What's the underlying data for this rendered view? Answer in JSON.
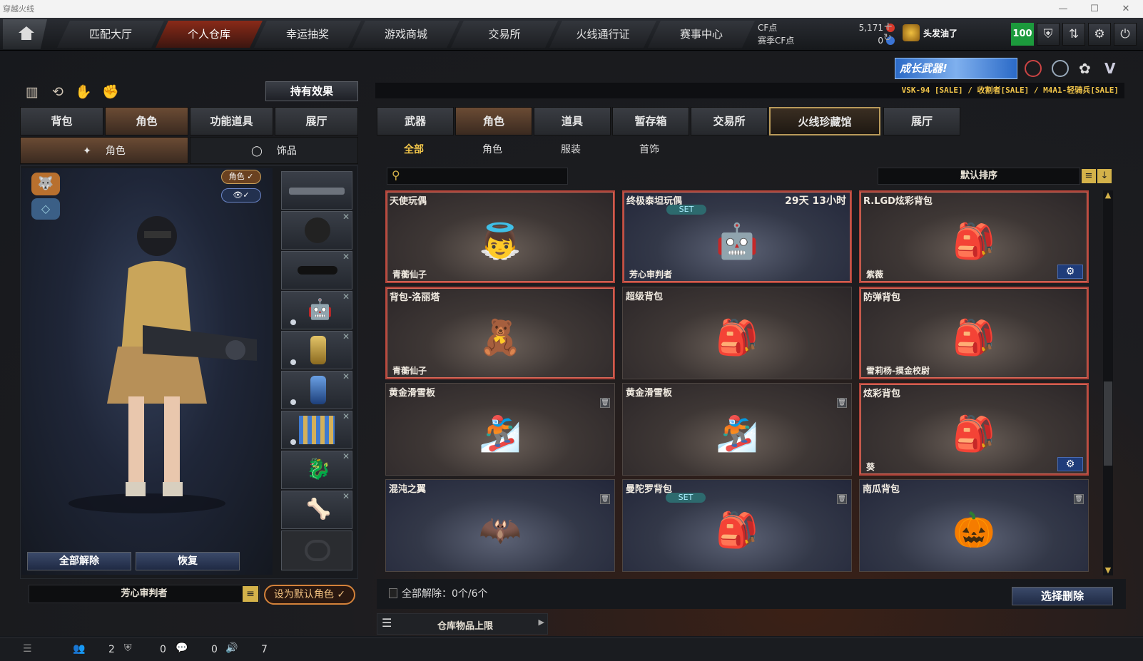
{
  "window": {
    "title": "穿越火线",
    "controls": [
      "—",
      "☐",
      "✕"
    ]
  },
  "nav": {
    "tabs": [
      {
        "label": "匹配大厅",
        "active": false
      },
      {
        "label": "个人仓库",
        "active": true
      },
      {
        "label": "幸运抽奖",
        "active": false
      },
      {
        "label": "游戏商城",
        "active": false
      },
      {
        "label": "交易所",
        "active": false
      },
      {
        "label": "火线通行证",
        "active": false
      },
      {
        "label": "赛事中心",
        "active": false
      }
    ],
    "cf_label": "CF点",
    "cf_value": "5,171",
    "season_label": "赛季CF点",
    "season_value": "0",
    "plus": "+",
    "refresh": "↻",
    "player_name": "头发油了",
    "level": "100"
  },
  "banner": {
    "text": "成长武器!",
    "ticker": "VSK-94  [SALE] / 收割者[SALE] / M4A1-轻骑兵[SALE]"
  },
  "left": {
    "hold_effect": "持有效果",
    "tabs": [
      "背包",
      "角色",
      "功能道具",
      "展厅"
    ],
    "active_tab": 1,
    "subtabs": [
      "角色",
      "饰品"
    ],
    "active_subtab": 0,
    "role_toggle": "角色 ✓",
    "eye_toggle": "✓",
    "unequip_all": "全部解除",
    "restore": "恢复",
    "character_name": "芳心审判者",
    "set_default": "设为默认角色 ✓"
  },
  "right": {
    "tabs": [
      "武器",
      "角色",
      "道具",
      "暂存箱",
      "交易所",
      "火线珍藏馆",
      "展厅"
    ],
    "active_tab": 1,
    "subtabs": [
      "全部",
      "角色",
      "服装",
      "首饰"
    ],
    "active_subtab": 0,
    "search_placeholder": "",
    "sort_label": "默认排序",
    "items": [
      {
        "name": "天使玩偶",
        "sub": "青蘅仙子",
        "time": "",
        "set": false,
        "trash": false,
        "gear": false,
        "selected": true,
        "icon": "angel-doll-icon",
        "glyph": "👼"
      },
      {
        "name": "终极泰坦玩偶",
        "sub": "芳心审判者",
        "time": "29天 13小时",
        "set": true,
        "trash": false,
        "gear": false,
        "selected": true,
        "icon": "titan-doll-icon",
        "glyph": "🤖"
      },
      {
        "name": "R.LGD炫彩背包",
        "sub": "紫薇",
        "time": "",
        "set": false,
        "trash": false,
        "gear": true,
        "selected": true,
        "icon": "backpack-icon",
        "glyph": "🎒"
      },
      {
        "name": "背包-洛丽塔",
        "sub": "青蘅仙子",
        "time": "",
        "set": false,
        "trash": false,
        "gear": false,
        "selected": true,
        "icon": "lolita-backpack-icon",
        "glyph": "🧸"
      },
      {
        "name": "超级背包",
        "sub": "",
        "time": "",
        "set": false,
        "trash": false,
        "gear": false,
        "selected": false,
        "icon": "super-backpack-icon",
        "glyph": "🎒"
      },
      {
        "name": "防弹背包",
        "sub": "雪莉杨-摸金校尉",
        "time": "",
        "set": false,
        "trash": false,
        "gear": false,
        "selected": true,
        "icon": "armored-backpack-icon",
        "glyph": "🎒"
      },
      {
        "name": "黄金滑雪板",
        "sub": "",
        "time": "",
        "set": false,
        "trash": true,
        "gear": false,
        "selected": false,
        "icon": "gold-snowboard-icon",
        "glyph": "🏂"
      },
      {
        "name": "黄金滑雪板",
        "sub": "",
        "time": "",
        "set": false,
        "trash": true,
        "gear": false,
        "selected": false,
        "icon": "gold-snowboard-icon",
        "glyph": "🏂"
      },
      {
        "name": "炫彩背包",
        "sub": "葵",
        "time": "",
        "set": false,
        "trash": false,
        "gear": true,
        "selected": true,
        "icon": "camo-backpack-icon",
        "glyph": "🎒"
      },
      {
        "name": "混沌之翼",
        "sub": "",
        "time": "",
        "set": false,
        "trash": true,
        "gear": false,
        "selected": false,
        "icon": "chaos-wings-icon",
        "glyph": "🦇"
      },
      {
        "name": "曼陀罗背包",
        "sub": "",
        "time": "",
        "set": true,
        "trash": true,
        "gear": false,
        "selected": false,
        "icon": "mandala-backpack-icon",
        "glyph": "🎒"
      },
      {
        "name": "南瓜背包",
        "sub": "",
        "time": "",
        "set": false,
        "trash": true,
        "gear": false,
        "selected": false,
        "icon": "pumpkin-backpack-icon",
        "glyph": "🎃"
      }
    ],
    "unequip_status": "全部解除：0个/6个",
    "select_delete": "选择删除",
    "warehouse_limit": "仓库物品上限"
  },
  "bottom": {
    "counts": [
      "2",
      "0",
      "0",
      "7"
    ]
  }
}
